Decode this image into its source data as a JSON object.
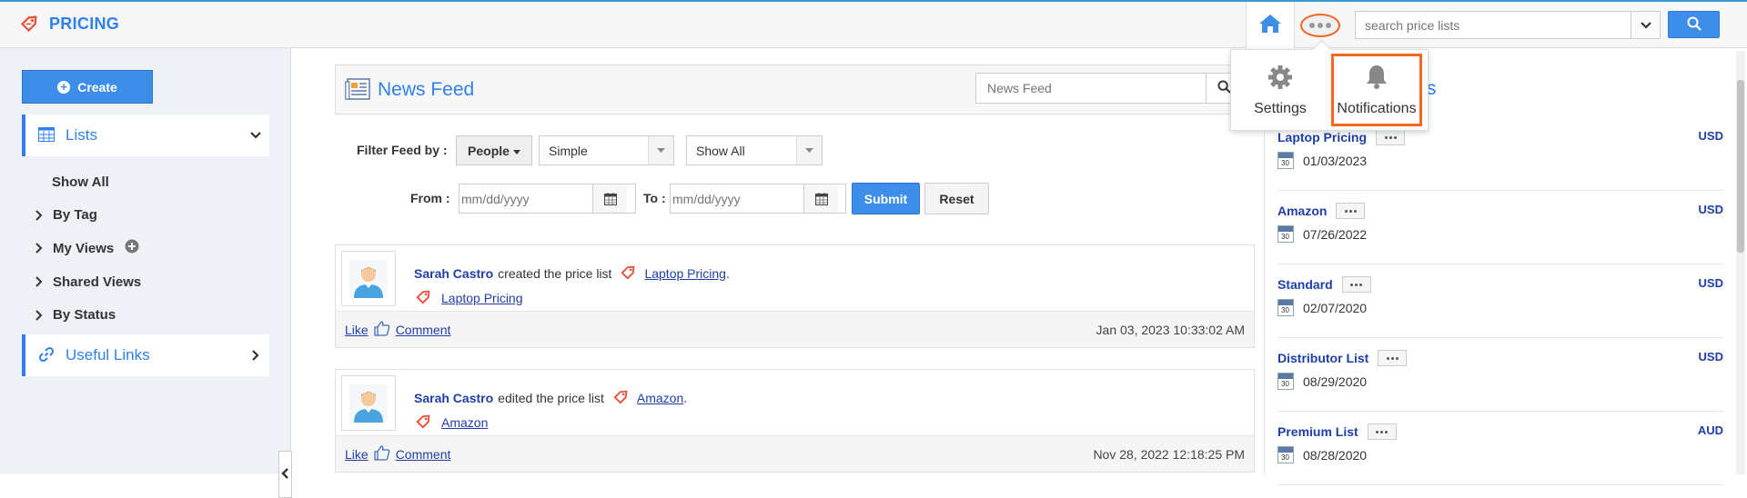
{
  "app": {
    "title": "PRICING"
  },
  "header": {
    "search_placeholder": "search price lists"
  },
  "popup": {
    "settings_label": "Settings",
    "notifications_label": "Notifications"
  },
  "sidebar": {
    "create_label": "Create",
    "lists_label": "Lists",
    "items": [
      {
        "label": "Show All"
      },
      {
        "label": "By Tag"
      },
      {
        "label": "My Views"
      },
      {
        "label": "Shared Views"
      },
      {
        "label": "By Status"
      }
    ],
    "useful_links_label": "Useful Links"
  },
  "feed": {
    "title": "News Feed",
    "search_placeholder": "News Feed",
    "filter_label": "Filter Feed by :",
    "people_label": "People",
    "type_value": "Simple",
    "show_value": "Show All",
    "from_label": "From :",
    "to_label": "To :",
    "date_placeholder": "mm/dd/yyyy",
    "submit_label": "Submit",
    "reset_label": "Reset",
    "entries": [
      {
        "user": "Sarah Castro",
        "action": "created the price list",
        "item": "Laptop Pricing",
        "item_link": "Laptop Pricing",
        "like": "Like",
        "comment": "Comment",
        "timestamp": "Jan 03, 2023 10:33:02 AM"
      },
      {
        "user": "Sarah Castro",
        "action": "edited the price list",
        "item": "Amazon",
        "item_link": "Amazon",
        "like": "Like",
        "comment": "Comment",
        "timestamp": "Nov 28, 2022 12:18:25 PM"
      }
    ]
  },
  "price_lists": {
    "partial_heading": "s",
    "items": [
      {
        "name": "Laptop Pricing",
        "date": "01/03/2023",
        "currency": "USD"
      },
      {
        "name": "Amazon",
        "date": "07/26/2022",
        "currency": "USD"
      },
      {
        "name": "Standard",
        "date": "02/07/2020",
        "currency": "USD"
      },
      {
        "name": "Distributor List",
        "date": "08/29/2020",
        "currency": "USD"
      },
      {
        "name": "Premium List",
        "date": "08/28/2020",
        "currency": "AUD"
      }
    ],
    "cal_day": "30"
  },
  "colors": {
    "brand": "#2f80ed",
    "highlight": "#f26522",
    "link": "#1f3fa8",
    "button": "#3d8ee8"
  }
}
